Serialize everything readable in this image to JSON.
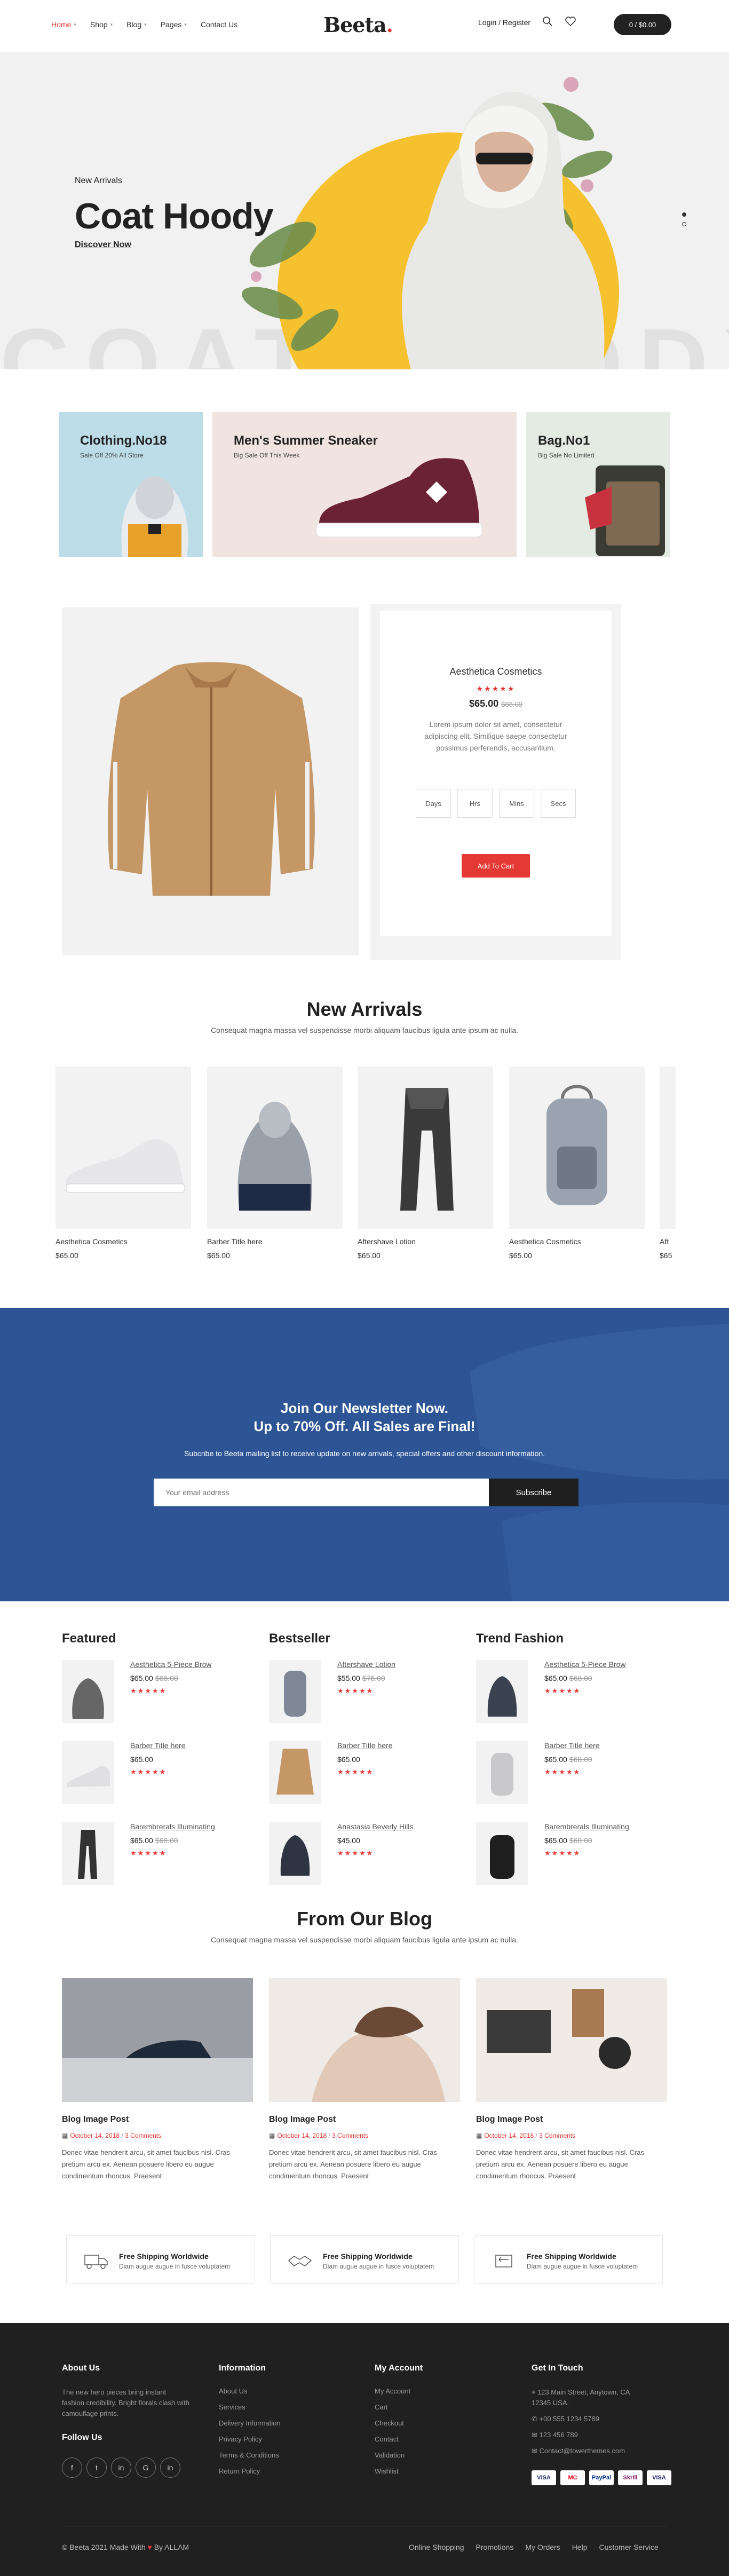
{
  "header": {
    "nav": [
      {
        "label": "Home",
        "active": true,
        "dropdown": true
      },
      {
        "label": "Shop",
        "dropdown": true
      },
      {
        "label": "Blog",
        "dropdown": true
      },
      {
        "label": "Pages",
        "dropdown": true
      },
      {
        "label": "Contact Us",
        "dropdown": false
      }
    ],
    "logo": "Beeta",
    "logo_dot": ".",
    "login": "Login / Register",
    "cart": "0 / $0.00"
  },
  "hero": {
    "subtitle": "New Arrivals",
    "title": "Coat Hoody",
    "link": "Discover Now",
    "watermark": "COAT HOODY"
  },
  "banners": [
    {
      "title": "Clothing.No18",
      "sub": "Sale Off 20% All Store"
    },
    {
      "title": "Men's Summer Sneaker",
      "sub": "Big Sale Off This Week"
    },
    {
      "title": "Bag.No1",
      "sub": "Big Sale No Limited"
    }
  ],
  "deal": {
    "title": "Aesthetica Cosmetics",
    "stars": "★★★★★",
    "price": "$65.00",
    "old_price": "$68.00",
    "text": "Lorem ipsum dolor sit amet, consectetur adipiscing elit. Similique saepe consectetur possimus perferendis, accusantium.",
    "countdown": [
      "Days",
      "Hrs",
      "Mins",
      "Secs"
    ],
    "button": "Add To Cart"
  },
  "new_arrivals": {
    "title": "New Arrivals",
    "subtitle": "Consequat magna massa vel suspendisse morbi aliquam faucibus ligula ante ipsum ac nulla.",
    "products": [
      {
        "name": "Aesthetica Cosmetics",
        "price": "$65.00"
      },
      {
        "name": "Barber Title here",
        "price": "$65.00"
      },
      {
        "name": "Aftershave Lotion",
        "price": "$65.00"
      },
      {
        "name": "Aesthetica Cosmetics",
        "price": "$65.00"
      },
      {
        "name": "Aft",
        "price": "$65"
      }
    ]
  },
  "newsletter": {
    "title1": "Join Our Newsletter Now.",
    "title2": "Up to 70% Off. All Sales are Final!",
    "sub": "Subcribe to Beeta mailing list to receive update on new arrivals, special offers and other discount information.",
    "placeholder": "Your email address",
    "button": "Subscribe"
  },
  "lists": [
    {
      "title": "Featured",
      "items": [
        {
          "name": "Aesthetica 5-Piece Brow",
          "price": "$65.00",
          "old": "$68.00"
        },
        {
          "name": "Barber Title here",
          "price": "$65.00",
          "old": ""
        },
        {
          "name": "Barembrerals Illuminating",
          "price": "$65.00",
          "old": "$68.00"
        }
      ]
    },
    {
      "title": "Bestseller",
      "items": [
        {
          "name": "Aftershave Lotion",
          "price": "$55.00",
          "old": "$76.00"
        },
        {
          "name": "Barber Title here",
          "price": "$65.00",
          "old": ""
        },
        {
          "name": "Anastasia Beverly Hills",
          "price": "$45.00",
          "old": ""
        }
      ]
    },
    {
      "title": "Trend Fashion",
      "items": [
        {
          "name": "Aesthetica 5-Piece Brow",
          "price": "$65.00",
          "old": "$68.00"
        },
        {
          "name": "Barber Title here",
          "price": "$65.00",
          "old": "$68.00"
        },
        {
          "name": "Barembrerals Illuminating",
          "price": "$65.00",
          "old": "$68.00"
        }
      ]
    }
  ],
  "list_stars": "★★★★★",
  "blog": {
    "title": "From Our Blog",
    "subtitle": "Consequat magna massa vel suspendisse morbi aliquam faucibus ligula ante ipsum ac nulla.",
    "posts": [
      {
        "title": "Blog Image Post",
        "date": "October 14, 2018",
        "comments": "3 Comments",
        "text": "Donec vitae hendrerit arcu, sit amet faucibus nisl. Cras pretium arcu ex. Aenean posuere libero eu augue condimentum rhoncus. Praesent"
      },
      {
        "title": "Blog Image Post",
        "date": "October 14, 2018",
        "comments": "3 Comments",
        "text": "Donec vitae hendrerit arcu, sit amet faucibus nisl. Cras pretium arcu ex. Aenean posuere libero eu augue condimentum rhoncus. Praesent"
      },
      {
        "title": "Blog Image Post",
        "date": "October 14, 2018",
        "comments": "3 Comments",
        "text": "Donec vitae hendrerit arcu, sit amet faucibus nisl. Cras pretium arcu ex. Aenean posuere libero eu augue condimentum rhoncus. Praesent"
      }
    ]
  },
  "features": [
    {
      "title": "Free Shipping Worldwide",
      "sub": "Diam augue augue in fusce voluptatem"
    },
    {
      "title": "Free Shipping Worldwide",
      "sub": "Diam augue augue in fusce voluptatem"
    },
    {
      "title": "Free Shipping Worldwide",
      "sub": "Diam augue augue in fusce voluptatem"
    }
  ],
  "footer": {
    "about_title": "About Us",
    "about_text": "The new hero pieces bring instant fashion credibility. Bright florals clash with camouflage prints.",
    "follow_title": "Follow Us",
    "social": [
      "f",
      "t",
      "in",
      "G",
      "in"
    ],
    "info_title": "Information",
    "info": [
      "About Us",
      "Services",
      "Delivery Information",
      "Privacy Policy",
      "Terms & Conditions",
      "Return Policy"
    ],
    "account_title": "My Account",
    "account": [
      "My Account",
      "Cart",
      "Checkout",
      "Contact",
      "Validation",
      "Wishlist"
    ],
    "contact_title": "Get In Touch",
    "contact": [
      "123 Main Street, Anytown, CA 12345 USA.",
      "+00 555 1234 5789",
      "123 456 789",
      "Contact@towerthemes.com"
    ],
    "payments": [
      "VISA",
      "MC",
      "PayPal",
      "Skrill",
      "VISA"
    ],
    "copyright": "© Beeta 2021 Made With",
    "copyright_by": "By ALLAM",
    "bottom_links": [
      "Online Shopping",
      "Promotions",
      "My Orders",
      "Help",
      "Customer Service"
    ]
  },
  "colors": {
    "accent": "#e53935",
    "hero_circle": "#f6c12f",
    "newsletter": "#2d5595",
    "footer": "#202020"
  }
}
